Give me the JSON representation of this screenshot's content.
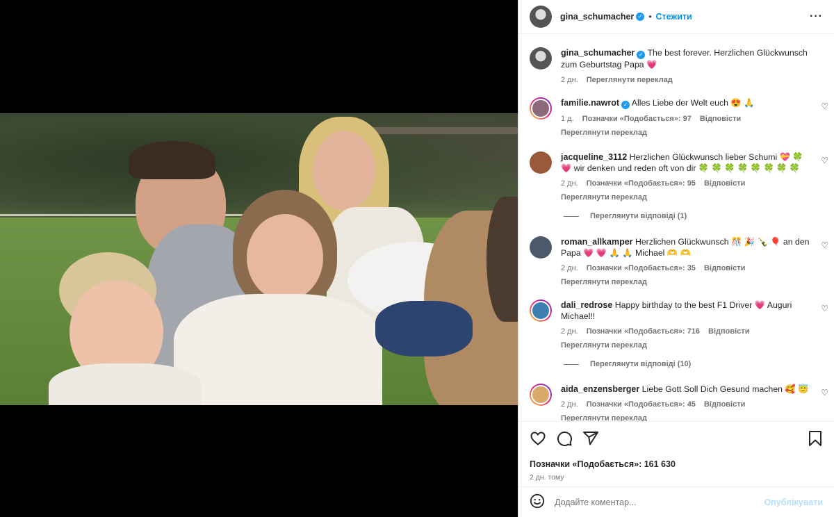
{
  "post": {
    "author": "gina_schumacher",
    "follow_label": "Стежити",
    "more_label": "···",
    "caption": "The best forever. Herzlichen Glückwunsch zum Geburtstag Papa 💗",
    "caption_age": "2 дн.",
    "caption_translate": "Переглянути переклад"
  },
  "comments": [
    {
      "user": "familie.nawrot",
      "verified": true,
      "text": "Alles Liebe der Welt euch 😍 🙏",
      "age": "1 д.",
      "likes": "Позначки «Подобається»: 97",
      "reply": "Відповісти",
      "translate": "Переглянути переклад",
      "avatar_color": "#8a6a7a",
      "story": true
    },
    {
      "user": "jacqueline_3112",
      "verified": false,
      "text": "Herzlichen Glückwunsch lieber Schumi 💝 🍀 💗 wir denken und reden oft von dir 🍀 🍀 🍀 🍀 🍀 🍀 🍀 🍀",
      "age": "2 дн.",
      "likes": "Позначки «Подобається»: 95",
      "reply": "Відповісти",
      "translate": "Переглянути переклад",
      "avatar_color": "#9a5a3a",
      "story": false,
      "view_replies": "Переглянути відповіді (1)"
    },
    {
      "user": "roman_allkamper",
      "verified": false,
      "text": "Herzlichen Glückwunsch 🎊 🎉 🍾 🎈 an den Papa 💗 💗 🙏 🙏 Michael 🫶 🫶",
      "age": "2 дн.",
      "likes": "Позначки «Подобається»: 35",
      "reply": "Відповісти",
      "translate": "Переглянути переклад",
      "avatar_color": "#4b5a6a",
      "story": false
    },
    {
      "user": "dali_redrose",
      "verified": false,
      "text": "Happy birthday to the best F1 Driver 💗 Auguri Michael!!",
      "age": "2 дн.",
      "likes": "Позначки «Подобається»: 716",
      "reply": "Відповісти",
      "translate": "Переглянути переклад",
      "avatar_color": "#3d7fb0",
      "story": true,
      "view_replies": "Переглянути відповіді (10)"
    },
    {
      "user": "aida_enzensberger",
      "verified": false,
      "text": "Liebe Gott Soll Dich Gesund machen 🥰 😇",
      "age": "2 дн.",
      "likes": "Позначки «Подобається»: 45",
      "reply": "Відповісти",
      "translate": "Переглянути переклад",
      "avatar_color": "#d9a96a",
      "story": true
    }
  ],
  "footer": {
    "likes": "Позначки «Подобається»: 161 630",
    "posted": "2 дн. тому",
    "comment_placeholder": "Додайте коментар...",
    "post_label": "Опублікувати"
  },
  "icons": {
    "like": "heart-icon",
    "comment": "comment-icon",
    "share": "share-icon",
    "save": "bookmark-icon",
    "emoji": "emoji-icon",
    "more": "more-icon",
    "verified": "verified-badge-icon"
  },
  "colors": {
    "link": "#0095f6",
    "verified": "#1d9bf0",
    "muted": "#737373",
    "post_disabled": "#b2dffc"
  }
}
